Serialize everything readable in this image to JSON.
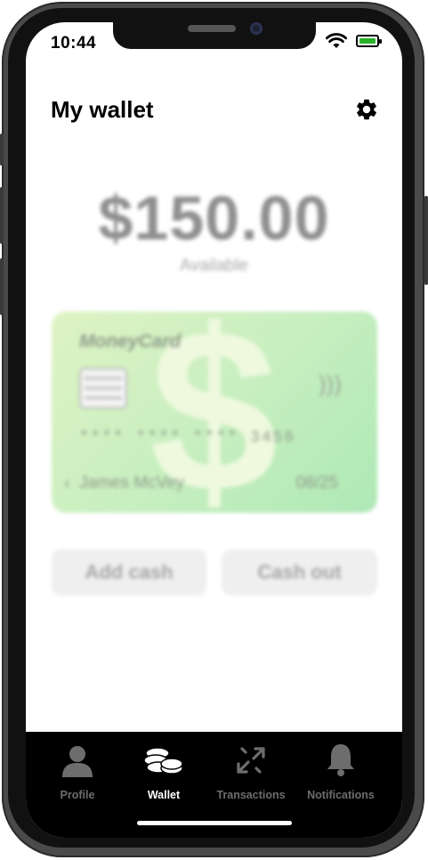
{
  "status_bar": {
    "time": "10:44"
  },
  "header": {
    "title": "My wallet"
  },
  "balance": {
    "amount": "$150.00",
    "label": "Available"
  },
  "card": {
    "brand": "MoneyCard",
    "number_masked": "**** **** **** 3456",
    "holder": "James McVey",
    "expiry": "08/25"
  },
  "actions": {
    "add_cash": "Add cash",
    "cash_out": "Cash out"
  },
  "tabs": [
    {
      "label": "Profile",
      "icon": "person-icon",
      "active": false
    },
    {
      "label": "Wallet",
      "icon": "coins-icon",
      "active": true
    },
    {
      "label": "Transactions",
      "icon": "arrows-icon",
      "active": false
    },
    {
      "label": "Notifications",
      "icon": "bell-icon",
      "active": false
    }
  ],
  "colors": {
    "battery": "#27b227",
    "card_start": "#dff3c4",
    "card_end": "#aee8b6",
    "tabbar": "#000000"
  }
}
